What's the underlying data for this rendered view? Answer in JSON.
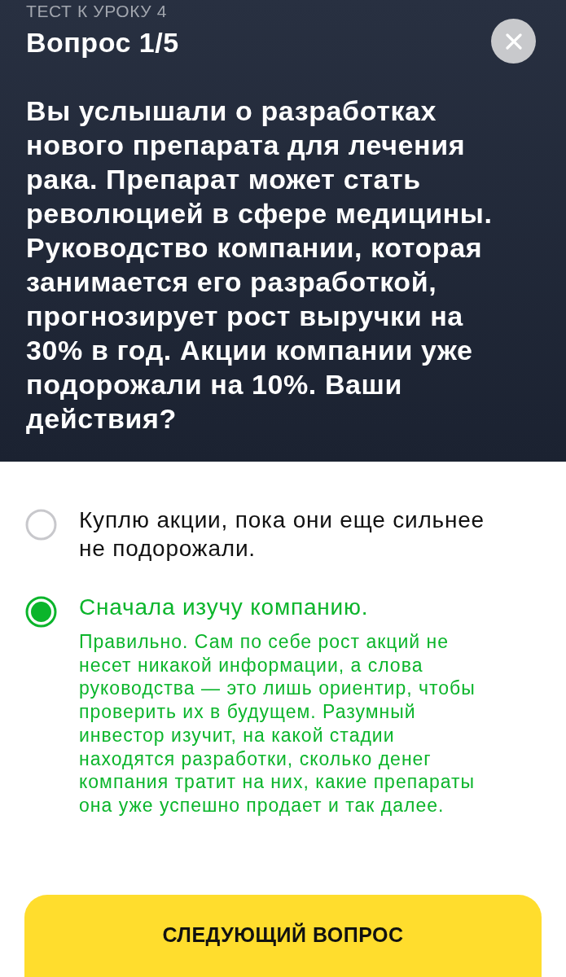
{
  "header": {
    "breadcrumb": "ТЕСТ К УРОКУ 4",
    "title": "Вопрос 1/5",
    "question": "Вы услышали о разработках нового препарата для лечения рака. Препарат может стать революцией в сфере медицины. Руководство компании, которая занимается его разработкой, прогнозирует рост выручки на 30% в год. Акции компании уже подорожали на 10%. Ваши действия?"
  },
  "options": [
    {
      "text": "Куплю акции, пока они еще сильнее не подорожали.",
      "selected": false
    },
    {
      "text": "Сначала изучу компанию.",
      "selected": true,
      "feedback": "Правильно. Сам по себе рост акций не несет никакой информации, а слова руководства — это лишь ориентир, чтобы проверить их в будущем. Разумный инвестор изучит, на какой стадии находятся разработки, сколько денег компания тратит на них, какие препараты она уже успешно продает и так далее."
    }
  ],
  "next_button": "СЛЕДУЮЩИЙ ВОПРОС"
}
